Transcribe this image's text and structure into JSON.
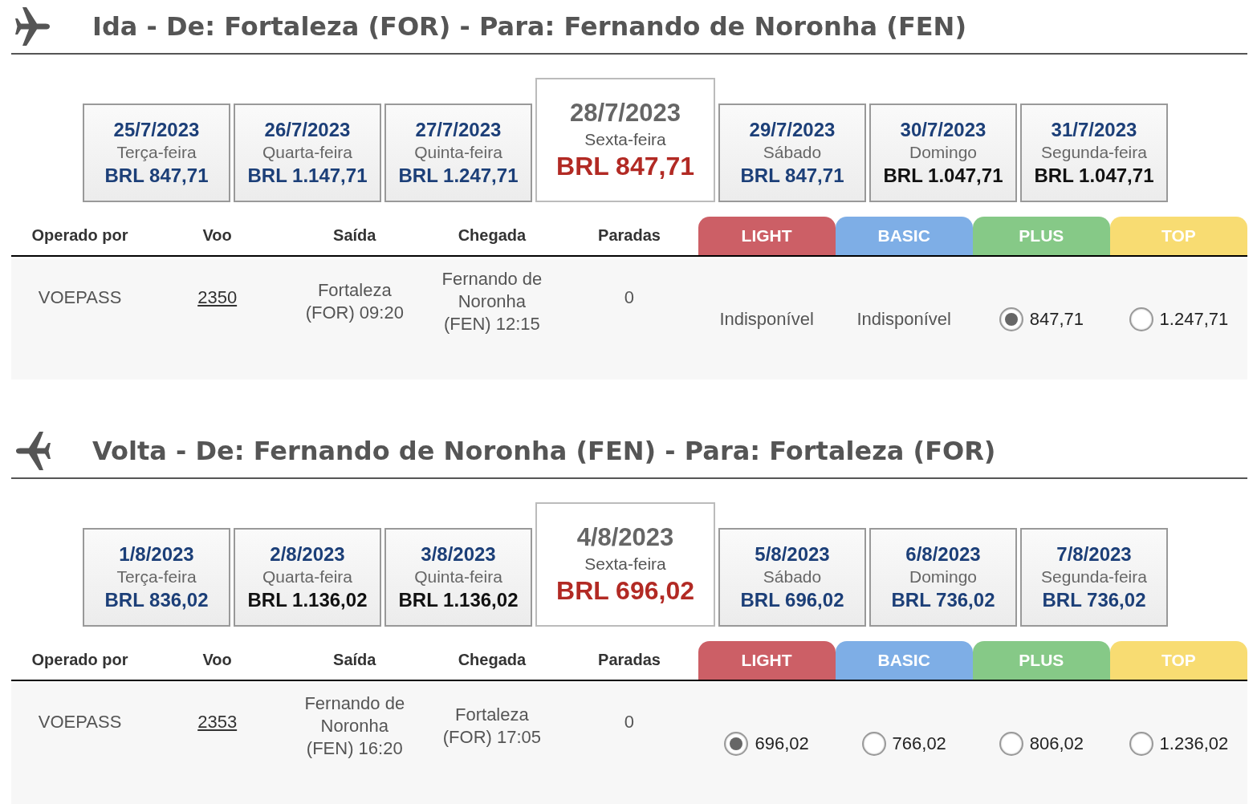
{
  "sections": [
    {
      "kind": "outbound",
      "title": "Ida - De: Fortaleza (FOR) - Para: Fernando de Noronha (FEN)",
      "dates": [
        {
          "date": "25/7/2023",
          "weekday": "Terça-feira",
          "price": "BRL 847,71",
          "color": "#1c3f78",
          "selected": false
        },
        {
          "date": "26/7/2023",
          "weekday": "Quarta-feira",
          "price": "BRL 1.147,71",
          "color": "#1c3f78",
          "selected": false
        },
        {
          "date": "27/7/2023",
          "weekday": "Quinta-feira",
          "price": "BRL 1.247,71",
          "color": "#1c3f78",
          "selected": false
        },
        {
          "date": "28/7/2023",
          "weekday": "Sexta-feira",
          "price": "BRL 847,71",
          "color": "#b22a24",
          "selected": true
        },
        {
          "date": "29/7/2023",
          "weekday": "Sábado",
          "price": "BRL 847,71",
          "color": "#1c3f78",
          "selected": false
        },
        {
          "date": "30/7/2023",
          "weekday": "Domingo",
          "price": "BRL 1.047,71",
          "color": "#111111",
          "selected": false
        },
        {
          "date": "31/7/2023",
          "weekday": "Segunda-feira",
          "price": "BRL 1.047,71",
          "color": "#111111",
          "selected": false
        }
      ],
      "columns": [
        "Operado por",
        "Voo",
        "Saída",
        "Chegada",
        "Paradas"
      ],
      "fares": [
        {
          "label": "LIGHT",
          "color": "#cc5f66"
        },
        {
          "label": "BASIC",
          "color": "#7eaee6"
        },
        {
          "label": "PLUS",
          "color": "#86c987"
        },
        {
          "label": "TOP",
          "color": "#f8dc72"
        }
      ],
      "flights": [
        {
          "operator": "VOEPASS",
          "flight": "2350",
          "departure": "Fortaleza (FOR) 09:20",
          "arrival": "Fernando de Noronha (FEN) 12:15",
          "stops": "0",
          "options": [
            {
              "kind": "unavailable",
              "text": "Indisponível"
            },
            {
              "kind": "unavailable",
              "text": "Indisponível"
            },
            {
              "kind": "radio",
              "text": "847,71",
              "selected": true
            },
            {
              "kind": "radio",
              "text": "1.247,71",
              "selected": false
            }
          ]
        }
      ]
    },
    {
      "kind": "return",
      "title": "Volta - De: Fernando de Noronha (FEN) - Para: Fortaleza (FOR)",
      "dates": [
        {
          "date": "1/8/2023",
          "weekday": "Terça-feira",
          "price": "BRL 836,02",
          "color": "#1c3f78",
          "selected": false
        },
        {
          "date": "2/8/2023",
          "weekday": "Quarta-feira",
          "price": "BRL 1.136,02",
          "color": "#111111",
          "selected": false
        },
        {
          "date": "3/8/2023",
          "weekday": "Quinta-feira",
          "price": "BRL 1.136,02",
          "color": "#111111",
          "selected": false
        },
        {
          "date": "4/8/2023",
          "weekday": "Sexta-feira",
          "price": "BRL 696,02",
          "color": "#b22a24",
          "selected": true
        },
        {
          "date": "5/8/2023",
          "weekday": "Sábado",
          "price": "BRL 696,02",
          "color": "#1c3f78",
          "selected": false
        },
        {
          "date": "6/8/2023",
          "weekday": "Domingo",
          "price": "BRL 736,02",
          "color": "#1c3f78",
          "selected": false
        },
        {
          "date": "7/8/2023",
          "weekday": "Segunda-feira",
          "price": "BRL 736,02",
          "color": "#1c3f78",
          "selected": false
        }
      ],
      "columns": [
        "Operado por",
        "Voo",
        "Saída",
        "Chegada",
        "Paradas"
      ],
      "fares": [
        {
          "label": "LIGHT",
          "color": "#cc5f66"
        },
        {
          "label": "BASIC",
          "color": "#7eaee6"
        },
        {
          "label": "PLUS",
          "color": "#86c987"
        },
        {
          "label": "TOP",
          "color": "#f8dc72"
        }
      ],
      "flights": [
        {
          "operator": "VOEPASS",
          "flight": "2353",
          "departure": "Fernando de Noronha (FEN) 16:20",
          "arrival": "Fortaleza (FOR) 17:05",
          "stops": "0",
          "options": [
            {
              "kind": "radio",
              "text": "696,02",
              "selected": true
            },
            {
              "kind": "radio",
              "text": "766,02",
              "selected": false
            },
            {
              "kind": "radio",
              "text": "806,02",
              "selected": false
            },
            {
              "kind": "radio",
              "text": "1.236,02",
              "selected": false
            }
          ]
        }
      ]
    }
  ]
}
